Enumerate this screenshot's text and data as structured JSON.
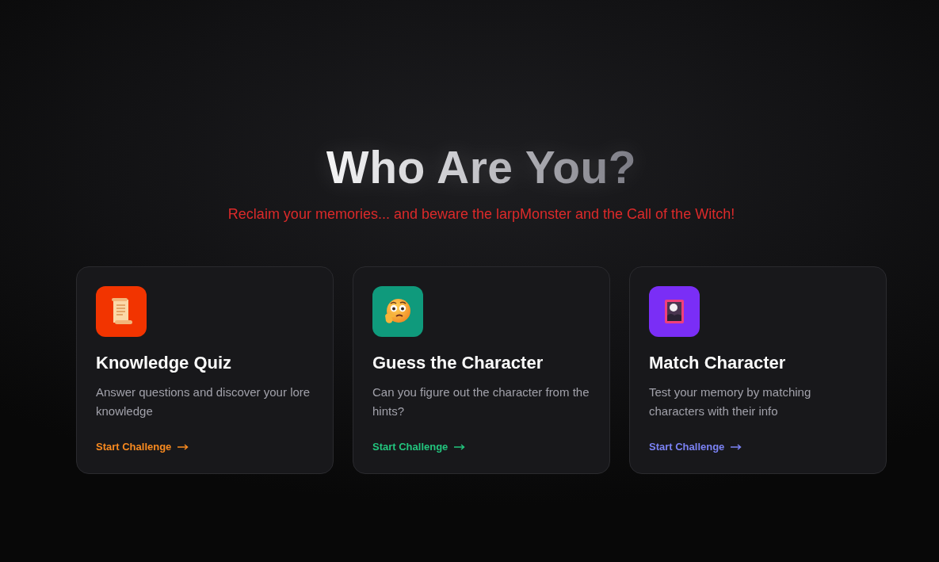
{
  "header": {
    "title": "Who Are You?",
    "subtitle": "Reclaim your memories... and beware the larpMonster and the Call of the Witch!"
  },
  "cards": [
    {
      "title": "Knowledge Quiz",
      "description": "Answer questions and discover your lore knowledge",
      "action": "Start Challenge",
      "color": "#f98a1f",
      "icon_tile": {
        "color": "#f23400"
      }
    },
    {
      "title": "Guess the Character",
      "description": "Can you figure out the character from the hints?",
      "action": "Start Challenge",
      "color": "#22c57e",
      "icon_tile": {
        "color": "#0f9a7c"
      }
    },
    {
      "title": "Match Character",
      "description": "Test your memory by matching characters with their info",
      "action": "Start Challenge",
      "color": "#7b82f4",
      "icon_tile": {
        "color": "#7a2ef6"
      }
    }
  ]
}
